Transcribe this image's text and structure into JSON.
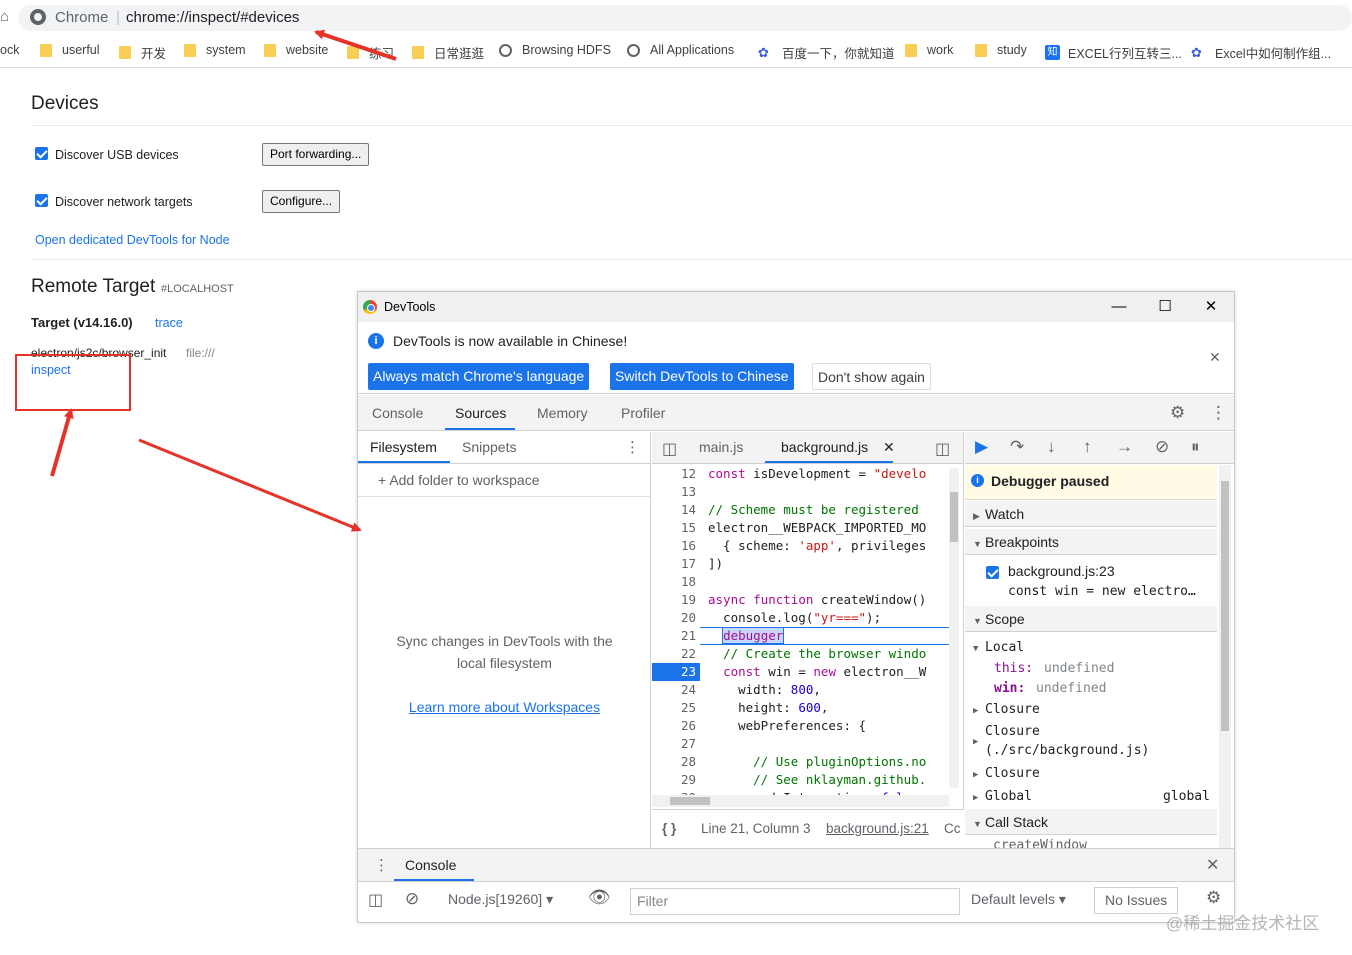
{
  "browser": {
    "site_name": "Chrome",
    "url": "chrome://inspect/#devices",
    "bookmarks": [
      {
        "label": "ock",
        "icon": "none"
      },
      {
        "label": "userful",
        "icon": "folder-icon"
      },
      {
        "label": "开发",
        "icon": "folder-icon"
      },
      {
        "label": "system",
        "icon": "folder-icon"
      },
      {
        "label": "website",
        "icon": "folder-icon"
      },
      {
        "label": "练习",
        "icon": "folder-icon"
      },
      {
        "label": "日常逛逛",
        "icon": "folder-icon"
      },
      {
        "label": "Browsing HDFS",
        "icon": "globe-icon"
      },
      {
        "label": "All Applications",
        "icon": "globe-icon"
      },
      {
        "label": "百度一下，你就知道",
        "icon": "baidu-icon"
      },
      {
        "label": "work",
        "icon": "folder-icon"
      },
      {
        "label": "study",
        "icon": "folder-icon"
      },
      {
        "label": "EXCEL行列互转三...",
        "icon": "zhihu-icon"
      },
      {
        "label": "Excel中如何制作组...",
        "icon": "baidu-icon"
      }
    ]
  },
  "inspect": {
    "title": "Devices",
    "discover_usb": "Discover USB devices",
    "port_forwarding": "Port forwarding...",
    "discover_network": "Discover network targets",
    "configure": "Configure...",
    "open_node": "Open dedicated DevTools for Node",
    "remote_target": "Remote Target",
    "host": "#LOCALHOST",
    "target_name": "Target (v14.16.0)",
    "trace": "trace",
    "target_path": "electron/js2c/browser_init",
    "target_url": "file:///",
    "inspect": "inspect"
  },
  "devtools": {
    "window_title": "DevTools",
    "info_message": "DevTools is now available in Chinese!",
    "btn_match": "Always match Chrome's language",
    "btn_switch": "Switch DevTools to Chinese",
    "btn_dont_show": "Don't show again",
    "tabs": [
      "Console",
      "Sources",
      "Memory",
      "Profiler"
    ],
    "active_tab": "Sources",
    "nav_tabs": [
      "Filesystem",
      "Snippets"
    ],
    "add_folder": "Add folder to workspace",
    "sync_text": "Sync changes in DevTools with the local filesystem",
    "learn_link": "Learn more about Workspaces",
    "editor_tabs": [
      "main.js",
      "background.js"
    ],
    "code_lines": [
      {
        "n": "12",
        "t": "const isDevelopment = \"develo"
      },
      {
        "n": "13",
        "t": ""
      },
      {
        "n": "14",
        "t": "// Scheme must be registered"
      },
      {
        "n": "15",
        "t": "electron__WEBPACK_IMPORTED_MO"
      },
      {
        "n": "16",
        "t": "  { scheme: 'app', privileges"
      },
      {
        "n": "17",
        "t": "])"
      },
      {
        "n": "18",
        "t": ""
      },
      {
        "n": "19",
        "t": "async function createWindow()"
      },
      {
        "n": "20",
        "t": "  console.log(\"yr===\");"
      },
      {
        "n": "21",
        "t": "  debugger"
      },
      {
        "n": "22",
        "t": "  // Create the browser windo"
      },
      {
        "n": "23",
        "t": "  const win = new electron__W"
      },
      {
        "n": "24",
        "t": "    width: 800,"
      },
      {
        "n": "25",
        "t": "    height: 600,"
      },
      {
        "n": "26",
        "t": "    webPreferences: {"
      },
      {
        "n": "27",
        "t": ""
      },
      {
        "n": "28",
        "t": "      // Use pluginOptions.no"
      },
      {
        "n": "29",
        "t": "      // See nklayman.github."
      },
      {
        "n": "30",
        "t": "      nodeIntegration: false,"
      }
    ],
    "current_line": "23",
    "status_position": "Line 21, Column 3",
    "status_file": "background.js:21",
    "status_tail": "Cc",
    "paused": "Debugger paused",
    "watch": "Watch",
    "breakpoints": "Breakpoints",
    "bp_file": "background.js:23",
    "bp_code": "const win = new electro…",
    "scope": "Scope",
    "local": "Local",
    "this_key": "this:",
    "this_val": "undefined",
    "win_key": "win:",
    "win_val": "undefined",
    "closure1": "Closure",
    "closure2a": "Closure",
    "closure2b": "(./src/background.js)",
    "closure3": "Closure",
    "global": "Global",
    "global_val": "global",
    "call_stack": "Call Stack",
    "call_stack_item": "createWindow",
    "drawer_tab": "Console",
    "context": "Node.js[19260]",
    "filter": "Filter",
    "levels": "Default levels",
    "issues": "No Issues"
  },
  "watermark": "@稀土掘金技术社区",
  "colors": {
    "accent": "#1a73e8",
    "annotation": "#e6332a",
    "paused_bg": "#fffbe5"
  }
}
